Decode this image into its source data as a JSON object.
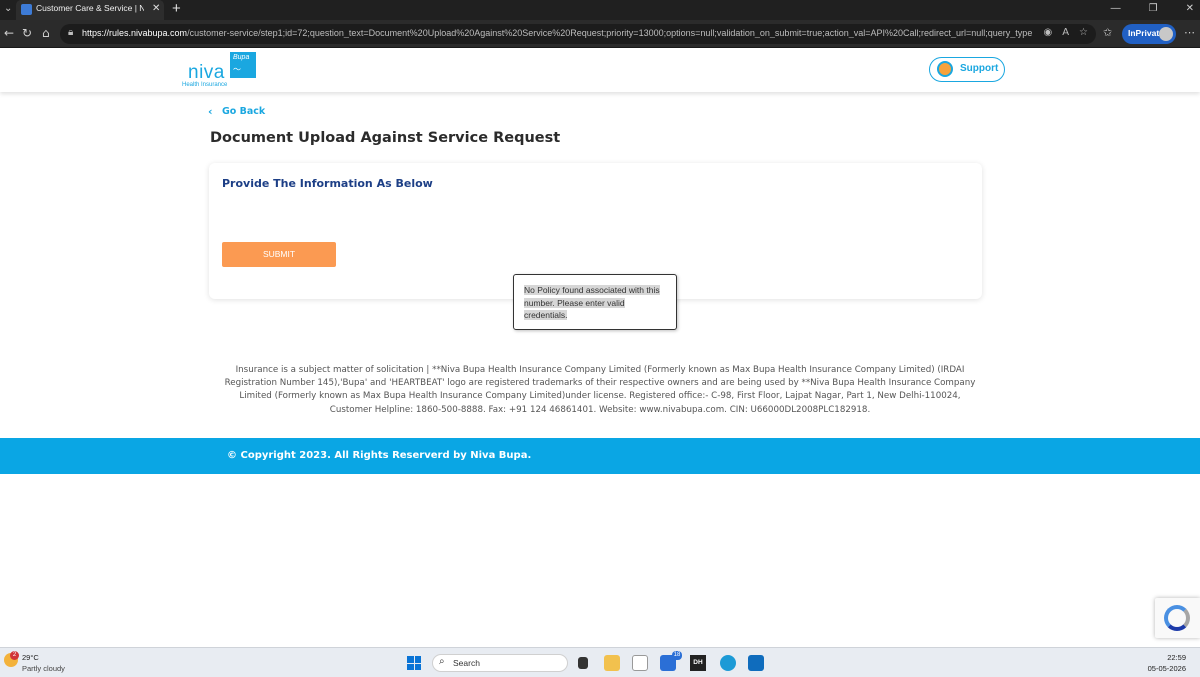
{
  "browser": {
    "tab_title": "Customer Care & Service | Niva Bupa",
    "url_host": "https://rules.nivabupa.com",
    "url_path": "/customer-service/step1;id=72;question_text=Document%20Upload%20Against%20Service%20Request;priority=13000;options=null;validation_on_submit=true;action_val=API%20Call;redirect_url=null;query_type_val=...",
    "inprivate_label": "InPrivate"
  },
  "header": {
    "logo_main": "niva",
    "logo_bupa": "Bupa",
    "logo_sub": "Health Insurance",
    "support_label": "Support"
  },
  "main": {
    "go_back_label": "Go Back",
    "page_title": "Document Upload Against Service Request",
    "card_heading": "Provide The Information As Below",
    "submit_label": "SUBMIT"
  },
  "tooltip": {
    "message": "No Policy found associated with this number. Please enter valid credentials."
  },
  "disclaimer": "Insurance is a subject matter of solicitation | **Niva Bupa Health Insurance Company Limited (Formerly known as Max Bupa Health Insurance Company Limited) (IRDAI Registration Number 145),'Bupa' and 'HEARTBEAT' logo are registered trademarks of their respective owners and are being used by **Niva Bupa Health Insurance Company Limited (Formerly known as Max Bupa Health Insurance Company Limited)under license. Registered office:- C-98, First Floor, Lajpat Nagar, Part 1, New Delhi-110024, Customer Helpline: 1860-500-8888. Fax: +91 124 46861401. Website: www.nivabupa.com. CIN: U66000DL2008PLC182918.",
  "footer": {
    "copyright": "© Copyright 2023. All Rights Reserverd by Niva Bupa."
  },
  "taskbar": {
    "weather_badge": "2",
    "weather_temp": "29°C",
    "weather_desc": "Partly cloudy",
    "search_label": "Search",
    "todo_badge": "18",
    "dh_label": "DH",
    "time": "22:59",
    "date": "05-05-2026"
  },
  "colors": {
    "brand_blue": "#1aa7e0",
    "heading_navy": "#1d3f86",
    "submit_orange": "#fb9a52",
    "footer_blue": "#0aa6e4"
  }
}
